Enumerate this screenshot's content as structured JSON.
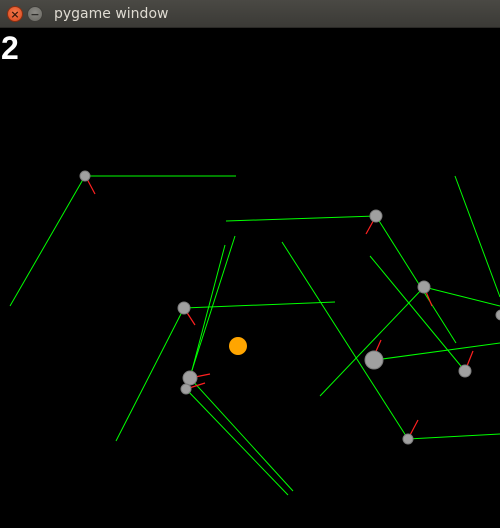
{
  "window": {
    "title": "pygame window"
  },
  "hud": {
    "score": "2"
  },
  "colors": {
    "background": "#000000",
    "ray": "#00ff00",
    "heading": "#ff0000",
    "agent": "#a0a0a0",
    "target": "#ffa500"
  },
  "icons": {
    "close": "close-icon",
    "minimize": "minimize-icon"
  }
}
